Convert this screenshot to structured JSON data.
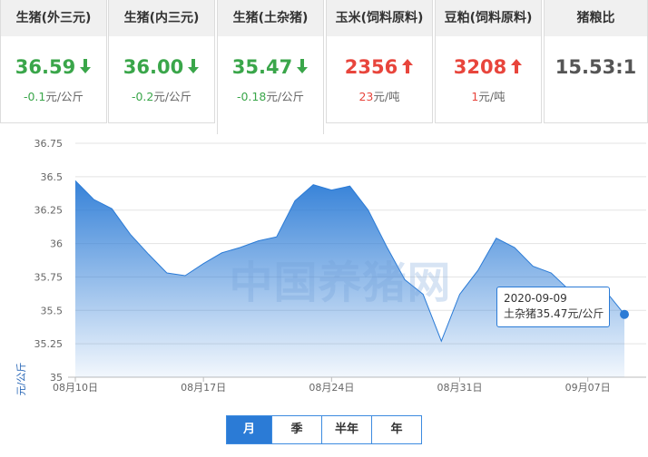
{
  "cards": [
    {
      "title": "生猪(外三元)",
      "price": "36.59",
      "trend": "down",
      "change_value": "-0.1",
      "change_unit": "元/公斤"
    },
    {
      "title": "生猪(内三元)",
      "price": "36.00",
      "trend": "down",
      "change_value": "-0.2",
      "change_unit": "元/公斤"
    },
    {
      "title": "生猪(土杂猪)",
      "price": "35.47",
      "trend": "down",
      "change_value": "-0.18",
      "change_unit": "元/公斤",
      "active": true
    },
    {
      "title": "玉米(饲料原料)",
      "price": "2356",
      "trend": "up",
      "change_value": "23",
      "change_unit": "元/吨"
    },
    {
      "title": "豆粕(饲料原料)",
      "price": "3208",
      "trend": "up",
      "change_value": "1",
      "change_unit": "元/吨"
    },
    {
      "title": "猪粮比",
      "price": "15.53:1",
      "trend": "flat",
      "change_value": "",
      "change_unit": ""
    }
  ],
  "colors": {
    "up": "#e8453c",
    "down": "#3aa64a",
    "series": "#2b7bd6"
  },
  "watermark": "中国养猪网",
  "tooltip": {
    "date": "2020-09-09",
    "text": "土杂猪35.47元/公斤"
  },
  "range_buttons": [
    {
      "label": "月",
      "active": true
    },
    {
      "label": "季",
      "active": false
    },
    {
      "label": "半年",
      "active": false
    },
    {
      "label": "年",
      "active": false
    }
  ],
  "chart_data": {
    "type": "area",
    "ylabel": "元/公斤",
    "ylim": [
      35,
      36.75
    ],
    "y_ticks": [
      "35",
      "35.25",
      "35.5",
      "35.75",
      "36",
      "36.25",
      "36.5",
      "36.75"
    ],
    "x_ticks": [
      "08月10日",
      "08月17日",
      "08月24日",
      "08月31日",
      "09月07日"
    ],
    "grid": true,
    "series": [
      {
        "x": [
          "2020-08-10",
          "2020-08-11",
          "2020-08-12",
          "2020-08-13",
          "2020-08-14",
          "2020-08-15",
          "2020-08-16",
          "2020-08-17",
          "2020-08-18",
          "2020-08-19",
          "2020-08-20",
          "2020-08-21",
          "2020-08-22",
          "2020-08-23",
          "2020-08-24",
          "2020-08-25",
          "2020-08-26",
          "2020-08-27",
          "2020-08-28",
          "2020-08-29",
          "2020-08-30",
          "2020-08-31",
          "2020-09-01",
          "2020-09-02",
          "2020-09-03",
          "2020-09-04",
          "2020-09-05",
          "2020-09-06",
          "2020-09-07",
          "2020-09-08",
          "2020-09-09"
        ],
        "values": [
          36.47,
          36.33,
          36.26,
          36.07,
          35.92,
          35.78,
          35.76,
          35.85,
          35.93,
          35.97,
          36.02,
          36.05,
          36.32,
          36.44,
          36.4,
          36.43,
          36.25,
          35.98,
          35.73,
          35.62,
          35.27,
          35.62,
          35.8,
          36.04,
          35.97,
          35.83,
          35.78,
          35.65,
          35.62,
          35.64,
          35.47
        ]
      }
    ]
  }
}
